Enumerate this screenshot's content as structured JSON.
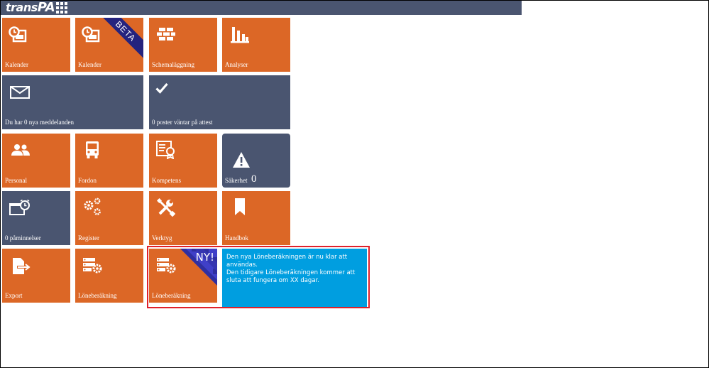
{
  "app": {
    "logo_text": "trans",
    "logo_text_pa": "PA",
    "colors": {
      "tile_orange": "#dc6726",
      "tile_slate": "#4a5570",
      "callout": "#009ee0",
      "highlight": "#e0202a",
      "ribbon": "#25237e"
    }
  },
  "tiles": {
    "kalender1": {
      "label": "Kalender",
      "icon": "calendar-clock-icon"
    },
    "kalender2": {
      "label": "Kalender",
      "icon": "calendar-clock-icon",
      "ribbon": "BETA"
    },
    "schemalaggning": {
      "label": "Schemaläggning",
      "icon": "bricks-icon"
    },
    "analyser": {
      "label": "Analyser",
      "icon": "bar-chart-icon"
    },
    "meddelanden": {
      "label": "Du har 0 nya meddelanden",
      "icon": "envelope-icon"
    },
    "attest": {
      "label": "0 poster väntar på attest",
      "icon": "checkmark-icon"
    },
    "personal": {
      "label": "Personal",
      "icon": "users-icon"
    },
    "fordon": {
      "label": "Fordon",
      "icon": "bus-icon"
    },
    "kompetens": {
      "label": "Kompetens",
      "icon": "certificate-icon"
    },
    "sakerhet": {
      "label": "Säkerhet",
      "icon": "warning-icon",
      "count": "0"
    },
    "paminnelser": {
      "label": "0 påminnelser",
      "icon": "alarm-window-icon"
    },
    "register": {
      "label": "Register",
      "icon": "gears-icon"
    },
    "verktyg": {
      "label": "Verktyg",
      "icon": "tools-icon"
    },
    "handbok": {
      "label": "Handbok",
      "icon": "bookmark-icon"
    },
    "export": {
      "label": "Export",
      "icon": "file-export-icon"
    },
    "loneberakning1": {
      "label": "Löneberäkning",
      "icon": "server-gear-icon"
    },
    "loneberakning2": {
      "label": "Löneberäkning",
      "icon": "server-gear-icon",
      "badge": "NY!"
    }
  },
  "callout": {
    "line1": "Den nya Löneberäkningen är nu klar att användas.",
    "line2": "Den tidigare Löneberäkningen kommer att sluta att fungera om XX dagar."
  }
}
